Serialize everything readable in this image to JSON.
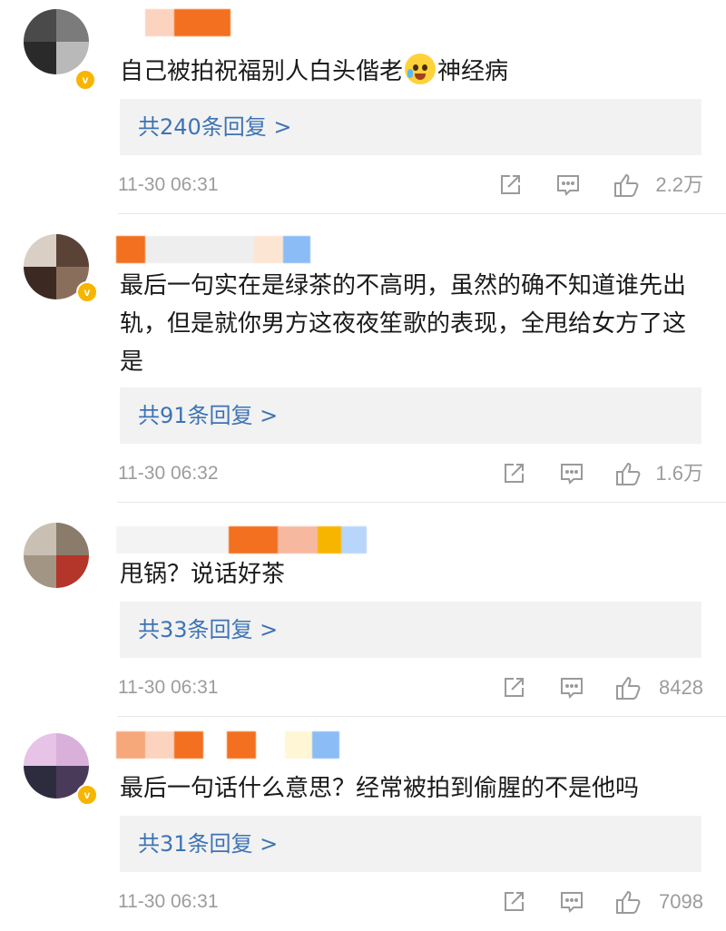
{
  "comments": [
    {
      "text": "自己被拍祝福别人白头偕老",
      "text_after_emoji": "神经病",
      "emoji": "crying-face-icon",
      "replies_label": "共240条回复 >",
      "time": "11-30 06:31",
      "likes": "2.2万"
    },
    {
      "text": "最后一句实在是绿茶的不高明，虽然的确不知道谁先出轨，但是就你男方这夜夜笙歌的表现，全甩给女方了这是",
      "replies_label": "共91条回复 >",
      "time": "11-30 06:32",
      "likes": "1.6万"
    },
    {
      "text": "甩锅？说话好茶",
      "replies_label": "共33条回复 >",
      "time": "11-30 06:31",
      "likes": "8428"
    },
    {
      "text": "最后一句话什么意思？经常被拍到偷腥的不是他吗",
      "replies_label": "共31条回复 >",
      "time": "11-30 06:31",
      "likes": "7098"
    }
  ],
  "colors": {
    "link": "#3d73b4",
    "meta": "#9c9c9c",
    "reply_bg": "#f2f2f2",
    "verified_badge": "#f7b500"
  }
}
